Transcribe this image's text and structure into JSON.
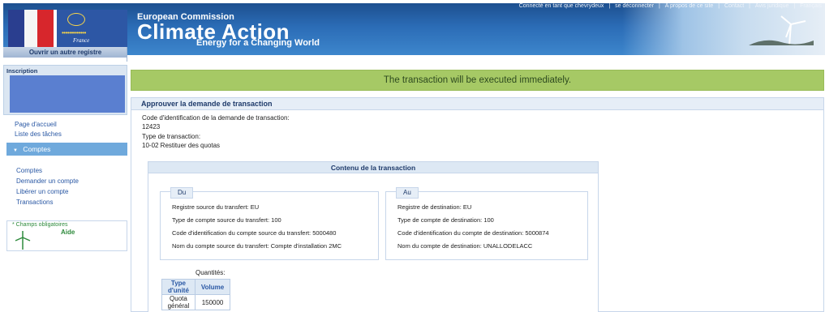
{
  "header": {
    "top_links": [
      "Connecté en tant que chevrydeux",
      "|",
      "se déconnecter",
      "|",
      "A propos de ce site",
      "|",
      "Contact",
      "|",
      "Avis juridique",
      "|",
      "Français"
    ],
    "country": "France",
    "ec_title": "European Commission",
    "app_title": "Climate Action",
    "tagline": "Energy for a Changing World"
  },
  "sidebar": {
    "open_register": "Ouvrir un autre registre",
    "login_title": "Inscription",
    "nav_top": [
      "Page d'accueil",
      "Liste des tâches"
    ],
    "section_title": "Comptes",
    "nav_sub": [
      "Comptes",
      "Demander un compte",
      "Libérer un compte",
      "Transactions"
    ],
    "required_note": "* Champs obligatoires",
    "help_label": "Aide"
  },
  "main": {
    "banner": "The transaction will be executed immediately.",
    "panel_title": "Approuver la demande de transaction",
    "id_label": "Code d'identification de la demande de transaction:",
    "id_value": "12423",
    "type_label": "Type de transaction:",
    "type_value": "10-02 Restituer des quotas",
    "content_title": "Contenu de la transaction",
    "source": {
      "tag": "Du",
      "lines": [
        "Registre source du transfert: EU",
        "Type de compte source du transfert: 100",
        "Code d'identification du compte source du transfert: 5000480",
        "Nom du compte source du transfert: Compte d'installation 2MC"
      ]
    },
    "destination": {
      "tag": "Au",
      "lines": [
        "Registre de destination: EU",
        "Type de compte de destination: 100",
        "Code d'identification du compte de destination: 5000874",
        "Nom du compte de destination: UNALLODELACC"
      ]
    },
    "quantities_label": "Quantités:",
    "quantities_headers": [
      "Type d'unité",
      "Volume"
    ],
    "quantities_rows": [
      [
        "Quota général",
        "150000"
      ]
    ]
  },
  "colors": {
    "header_blue": "#2b6cb6",
    "banner_green": "#a6c965",
    "link_blue": "#2a58a4",
    "section_head_blue": "#6fa9dc",
    "panel_head": "#e6eef7"
  }
}
